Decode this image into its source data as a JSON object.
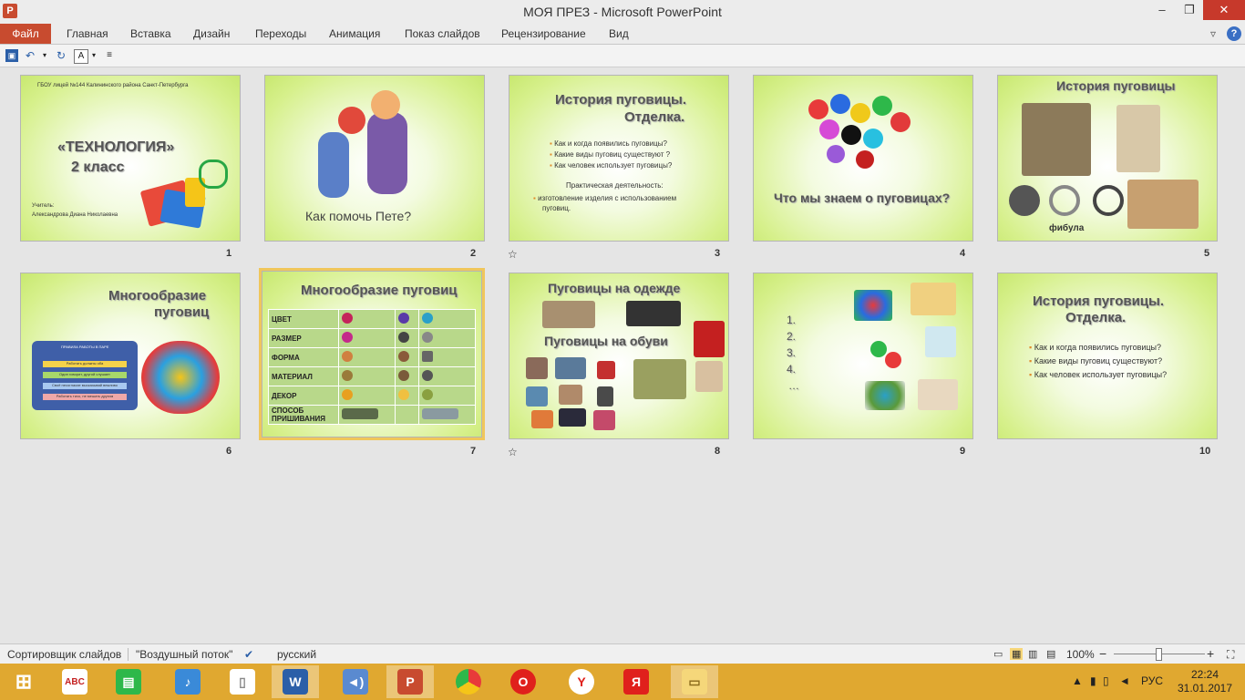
{
  "window": {
    "title": "МОЯ ПРЕЗ - Microsoft PowerPoint",
    "app_icon": "P",
    "minimize": "–",
    "maximize": "❐",
    "close": "✕"
  },
  "ribbon": {
    "tabs": [
      "Файл",
      "Главная",
      "Вставка",
      "Дизайн",
      "Переходы",
      "Анимация",
      "Показ слайдов",
      "Рецензирование",
      "Вид"
    ],
    "help": "?"
  },
  "slides": [
    {
      "num": "1",
      "org": "ГБОУ лицей №144 Калининского района Санкт-Петербурга",
      "title1": "«ТЕХНОЛОГИЯ»",
      "title2": "2 класс",
      "teacher1": "Учитель:",
      "teacher2": "Александрова Диана Николаевна"
    },
    {
      "num": "2",
      "title": "Как помочь Пете?"
    },
    {
      "num": "3",
      "title1": "История пуговицы.",
      "title2": "Отделка.",
      "bullets": [
        "Как и когда появились пуговицы?",
        "Какие виды пуговиц существуют ?",
        "Как человек использует пуговицы?"
      ],
      "sub": "Практическая деятельность:",
      "sub_bullet": "изготовление изделия с использованием",
      "sub_bullet2": "пуговиц."
    },
    {
      "num": "4",
      "title": "Что мы знаем о пуговицах?"
    },
    {
      "num": "5",
      "title": "История пуговицы",
      "caption": "фибула"
    },
    {
      "num": "6",
      "title1": "Многообразие",
      "title2": "пуговиц",
      "board_title": "ПРАВИЛА РАБОТЫ В ПАРЕ",
      "rule1": "Работать должны оба",
      "rule2": "Один говорит, другой слушает",
      "rule3": "Своё несогласие высказывай вежливо",
      "rule4": "Работать тихо, не мешать другим"
    },
    {
      "num": "7",
      "title": "Многообразие пуговиц",
      "rows": [
        "ЦВЕТ",
        "РАЗМЕР",
        "ФОРМА",
        "МАТЕРИАЛ",
        "ДЕКОР",
        "СПОСОБ ПРИШИВАНИЯ"
      ]
    },
    {
      "num": "8",
      "title1": "Пуговицы на одежде",
      "title2": "Пуговицы на обуви"
    },
    {
      "num": "9",
      "list": [
        "1.",
        "2.",
        "3.",
        "4.",
        "…"
      ]
    },
    {
      "num": "10",
      "title1": "История пуговицы.",
      "title2": "Отделка.",
      "bullets": [
        "Как и когда появились пуговицы?",
        "Какие виды пуговиц существуют?",
        "Как человек использует пуговицы?"
      ]
    }
  ],
  "status": {
    "view": "Сортировщик слайдов",
    "theme": "\"Воздушный поток\"",
    "lang": "русский",
    "zoom": "100%",
    "zoom_minus": "−",
    "zoom_plus": "+"
  },
  "taskbar": {
    "lang": "РУС",
    "time": "22:24",
    "date": "31.01.2017",
    "icons": [
      "windows-start",
      "abc-net",
      "store",
      "music",
      "document",
      "word",
      "speaker",
      "powerpoint",
      "chrome",
      "opera",
      "yandex",
      "yandex-browser",
      "explorer"
    ]
  }
}
